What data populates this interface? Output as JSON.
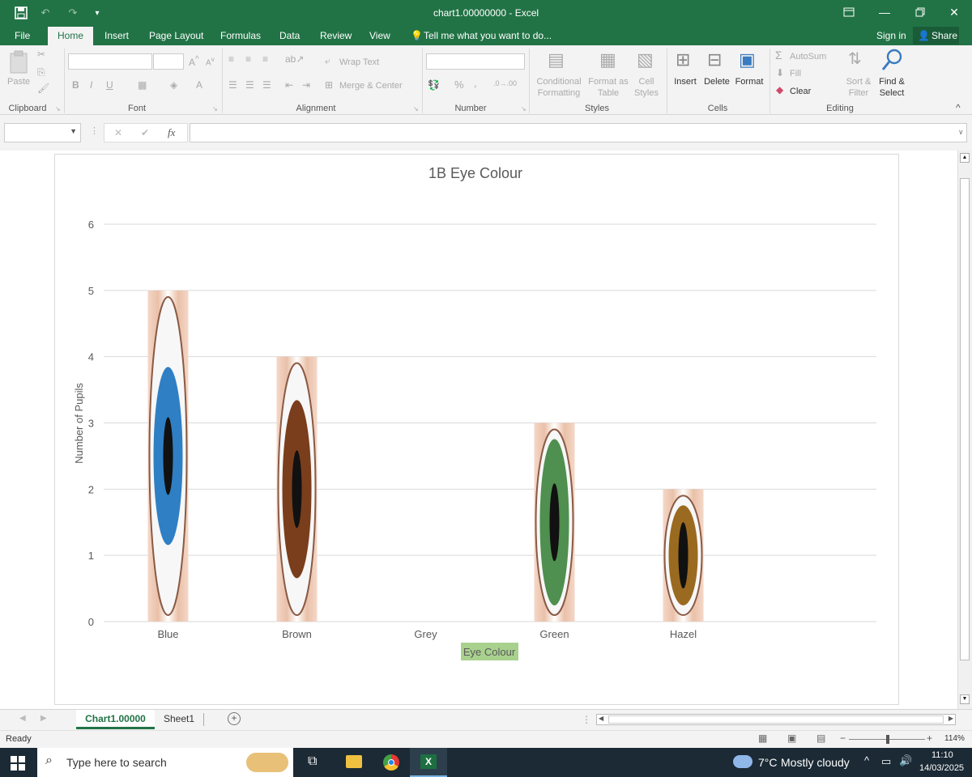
{
  "window": {
    "title": "chart1.00000000 - Excel"
  },
  "menu": {
    "file": "File",
    "home": "Home",
    "insert": "Insert",
    "page_layout": "Page Layout",
    "formulas": "Formulas",
    "data": "Data",
    "review": "Review",
    "view": "View",
    "tell_me": "Tell me what you want to do...",
    "sign_in": "Sign in",
    "share": "Share"
  },
  "ribbon": {
    "paste": "Paste",
    "clipboard": "Clipboard",
    "font": "Font",
    "bold": "B",
    "italic": "I",
    "underline": "U",
    "wrap_text": "Wrap Text",
    "merge_center": "Merge & Center",
    "alignment": "Alignment",
    "percent": "%",
    "comma": ",",
    "number": "Number",
    "conditional_1": "Conditional",
    "conditional_2": "Formatting",
    "format_table_1": "Format as",
    "format_table_2": "Table",
    "cell_styles_1": "Cell",
    "cell_styles_2": "Styles",
    "styles": "Styles",
    "insert": "Insert",
    "delete": "Delete",
    "format": "Format",
    "cells": "Cells",
    "autosum": "AutoSum",
    "fill": "Fill",
    "clear": "Clear",
    "sort_1": "Sort &",
    "sort_2": "Filter",
    "find_1": "Find &",
    "find_2": "Select",
    "editing": "Editing"
  },
  "formula_bar": {
    "fx": "fx",
    "cancel": "✕",
    "enter": "✔",
    "value": ""
  },
  "chart_data": {
    "type": "bar",
    "title": "1B Eye Colour",
    "xlabel": "Eye Colour",
    "ylabel": "Number of Pupils",
    "categories": [
      "Blue",
      "Brown",
      "Grey",
      "Green",
      "Hazel"
    ],
    "values": [
      5,
      4,
      0,
      3,
      2
    ],
    "ylim": [
      0,
      6
    ],
    "yticks": [
      "0",
      "1",
      "2",
      "3",
      "4",
      "5",
      "6"
    ],
    "grid": true,
    "bar_fill": "eye photographs",
    "iris_colors": [
      "#2f7fc4",
      "#7a3e1c",
      "#9a9a9a",
      "#4f8f4f",
      "#9a6a20"
    ]
  },
  "sheets": {
    "active": "Chart1.00000",
    "other": "Sheet1"
  },
  "status": {
    "ready": "Ready",
    "zoom": "114%"
  },
  "taskbar": {
    "search": "Type here to search",
    "temp": "7°C",
    "weather": "Mostly cloudy",
    "time": "11:10",
    "date": "14/03/2025"
  }
}
